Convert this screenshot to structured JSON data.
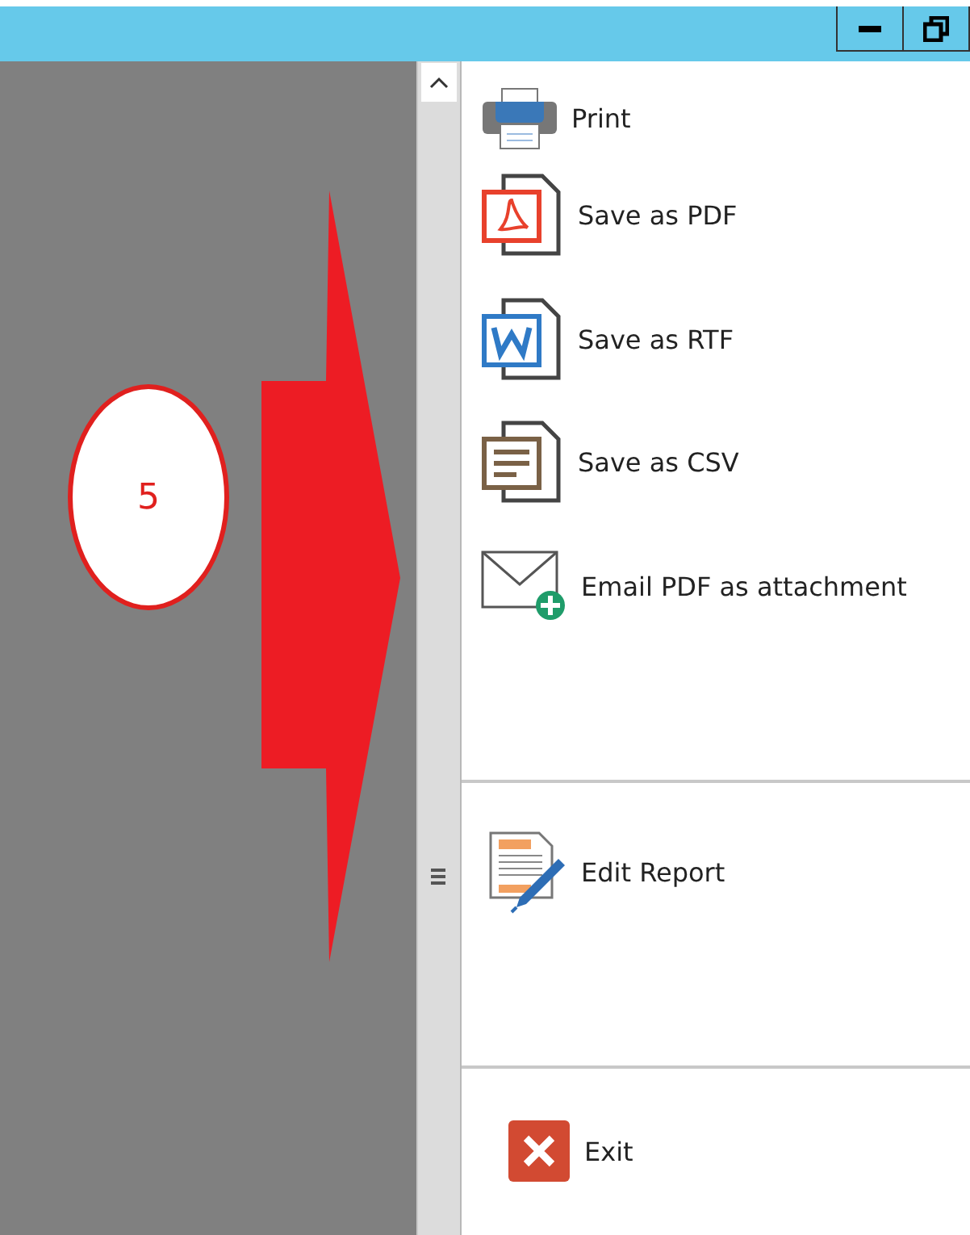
{
  "annotation": {
    "label": "5"
  },
  "menu_groups": [
    {
      "items": [
        {
          "label": "Print",
          "kind": "print"
        },
        {
          "label": "Save as PDF",
          "kind": "pdf"
        },
        {
          "label": "Save as RTF",
          "kind": "rtf"
        },
        {
          "label": "Save as CSV",
          "kind": "csv"
        },
        {
          "label": "Email PDF as attachment",
          "kind": "email"
        }
      ]
    },
    {
      "items": [
        {
          "label": "Edit Report",
          "kind": "edit"
        }
      ]
    },
    {
      "items": [
        {
          "label": "Exit",
          "kind": "exit"
        }
      ]
    }
  ]
}
